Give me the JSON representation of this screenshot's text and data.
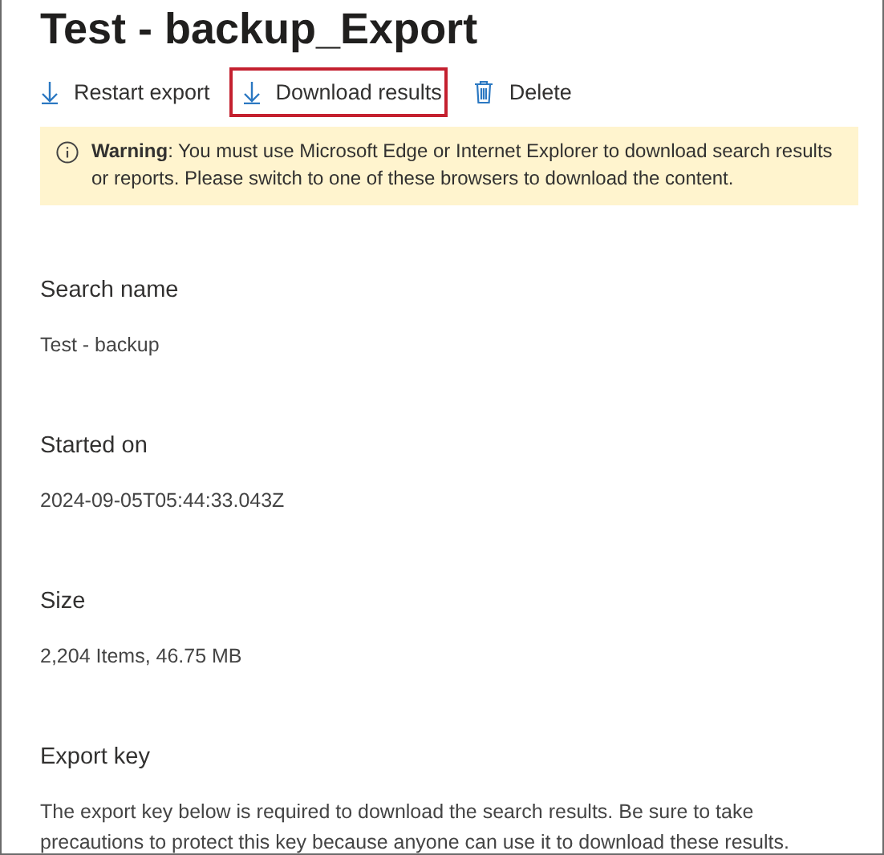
{
  "title": "Test - backup_Export",
  "toolbar": [
    {
      "kind": "download",
      "label": "Restart export",
      "highlighted": false
    },
    {
      "kind": "download",
      "label": "Download results",
      "highlighted": true
    },
    {
      "kind": "delete",
      "label": "Delete",
      "highlighted": false
    }
  ],
  "warning": {
    "text": "**Warning**: You must use Microsoft Edge or Internet Explorer to download search results or reports. Please switch to one of these browsers to download the content."
  },
  "fields": [
    {
      "label": "Search name",
      "value": "Test - backup"
    },
    {
      "label": "Started on",
      "value": "2024-09-05T05:44:33.043Z"
    },
    {
      "label": "Size",
      "value": "2,204 Items, 46.75 MB"
    },
    {
      "label": "Export key",
      "value": "The export key below is required to download the search results. Be sure to take precautions to protect this key because anyone can use it to download these results."
    }
  ]
}
